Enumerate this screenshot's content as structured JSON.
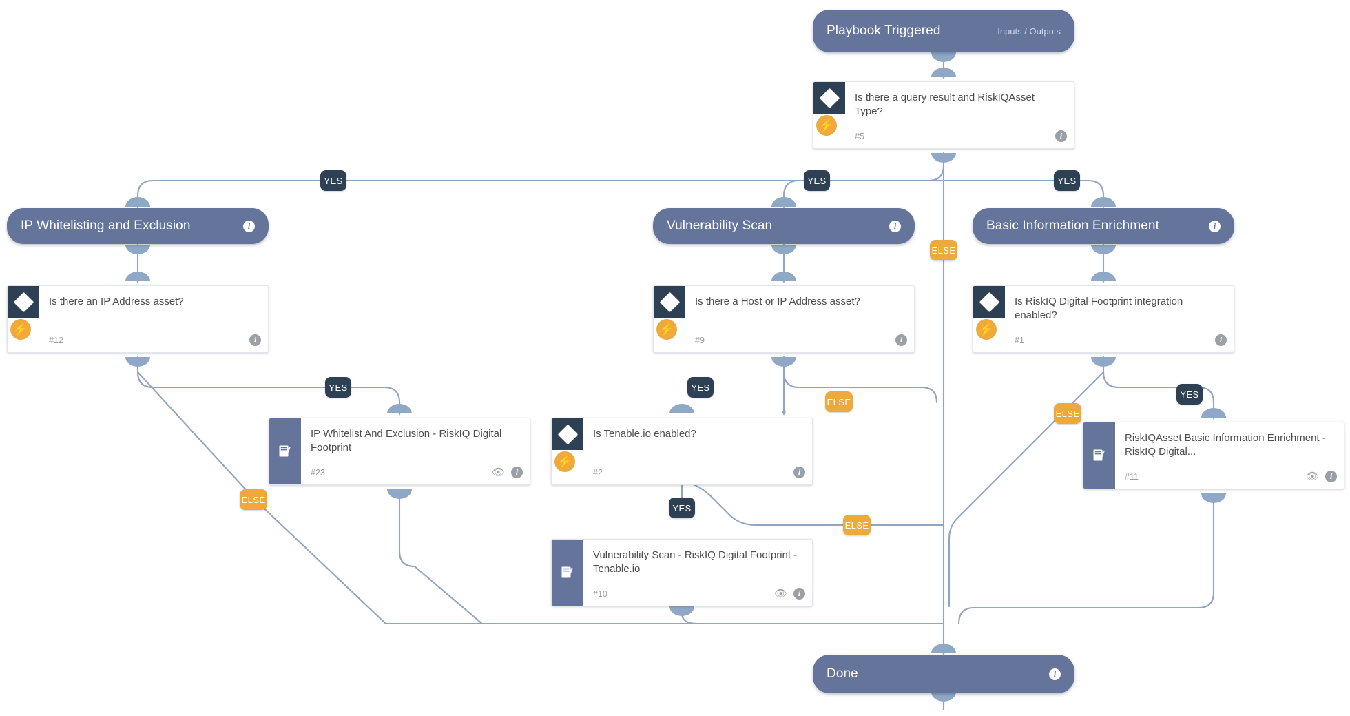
{
  "diagram": {
    "type": "playbook-flow",
    "title": "RiskIQ Digital Footprint playbook"
  },
  "nodes": {
    "start": {
      "label": "Playbook Triggered",
      "sub": "Inputs / Outputs",
      "kind": "start",
      "info_icon": "info-icon"
    },
    "cond5": {
      "title": "Is there a query result and RiskIQAsset Type?",
      "id": "#5",
      "kind": "condition",
      "icons": [
        "diamond-icon",
        "lightning-bolt-icon",
        "info-icon"
      ]
    },
    "section_ip": {
      "label": "IP Whitelisting and Exclusion",
      "kind": "section",
      "info_icon": "info-icon"
    },
    "section_vuln": {
      "label": "Vulnerability Scan",
      "kind": "section",
      "info_icon": "info-icon"
    },
    "section_basic": {
      "label": "Basic Information Enrichment",
      "kind": "section",
      "info_icon": "info-icon"
    },
    "cond12": {
      "title": "Is there an IP Address asset?",
      "id": "#12",
      "kind": "condition"
    },
    "cond9": {
      "title": "Is there a Host or IP Address asset?",
      "id": "#9",
      "kind": "condition"
    },
    "cond1": {
      "title": "Is RiskIQ Digital Footprint integration enabled?",
      "id": "#1",
      "kind": "condition"
    },
    "task23": {
      "title": "IP Whitelist And Exclusion - RiskIQ Digital Footprint",
      "id": "#23",
      "kind": "subplaybook",
      "icons": [
        "book-icon",
        "eye-icon",
        "info-icon"
      ]
    },
    "cond2": {
      "title": "Is Tenable.io enabled?",
      "id": "#2",
      "kind": "condition"
    },
    "task11": {
      "title": "RiskIQAsset Basic Information Enrichment - RiskIQ Digital...",
      "id": "#11",
      "kind": "subplaybook",
      "icons": [
        "book-icon",
        "eye-icon",
        "info-icon"
      ]
    },
    "task10": {
      "title": "Vulnerability Scan - RiskIQ Digital Footprint - Tenable.io",
      "id": "#10",
      "kind": "subplaybook",
      "icons": [
        "book-icon",
        "eye-icon",
        "info-icon"
      ]
    },
    "done": {
      "label": "Done",
      "kind": "end",
      "info_icon": "info-icon"
    }
  },
  "edge_labels": {
    "yes_left_top": "YES",
    "yes_center_top": "YES",
    "yes_right_top": "YES",
    "else_center_top": "ELSE",
    "yes_12": "YES",
    "else_12": "ELSE",
    "yes_9": "YES",
    "else_9": "ELSE",
    "yes_1": "YES",
    "else_1": "ELSE",
    "yes_2": "YES",
    "else_2": "ELSE"
  },
  "colors": {
    "pill": "#64749b",
    "condition_swatch": "#2e4053",
    "bolt": "#f0a93b",
    "yes_badge": "#2e4053",
    "else_badge": "#eda93a",
    "edge": "#8fa5c0",
    "port": "#8fa8c6",
    "card_title": "#4c4c4c",
    "card_id": "#9aa0a6"
  }
}
